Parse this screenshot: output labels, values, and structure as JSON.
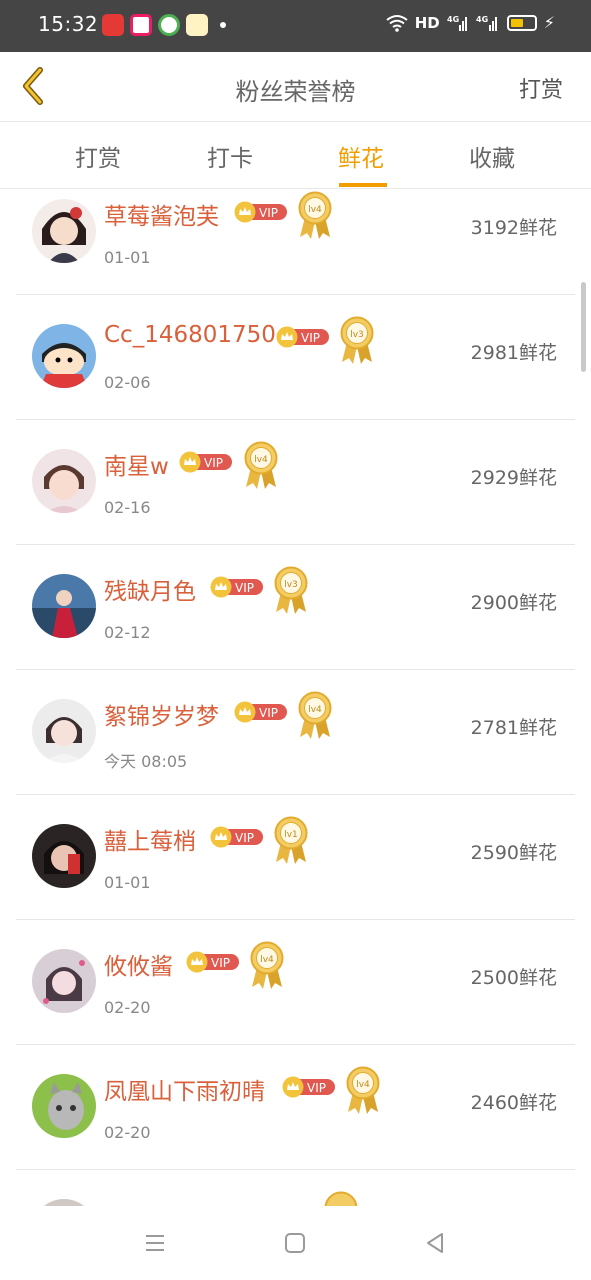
{
  "status_bar": {
    "time": "15:32",
    "network": "HD",
    "signal1": "4G",
    "signal2": "4G"
  },
  "header": {
    "title": "粉丝荣誉榜",
    "action": "打赏"
  },
  "tabs": [
    {
      "label": "打赏",
      "active": false
    },
    {
      "label": "打卡",
      "active": false
    },
    {
      "label": "鲜花",
      "active": true
    },
    {
      "label": "收藏",
      "active": false
    }
  ],
  "vip_label": "VIP",
  "rows": [
    {
      "name": "草莓酱泡芙",
      "date": "01-01",
      "level": "lv4",
      "count": "3192鲜花"
    },
    {
      "name": "Cc_146801750",
      "date": "02-06",
      "level": "lv3",
      "count": "2981鲜花"
    },
    {
      "name": "南星w",
      "date": "02-16",
      "level": "lv4",
      "count": "2929鲜花"
    },
    {
      "name": "残缺月色",
      "date": "02-12",
      "level": "lv3",
      "count": "2900鲜花"
    },
    {
      "name": "絮锦岁岁梦",
      "date": "今天 08:05",
      "level": "lv4",
      "count": "2781鲜花"
    },
    {
      "name": "囍上莓梢",
      "date": "01-01",
      "level": "lv1",
      "count": "2590鲜花"
    },
    {
      "name": "攸攸酱",
      "date": "02-20",
      "level": "lv4",
      "count": "2500鲜花"
    },
    {
      "name": "凤凰山下雨初晴",
      "date": "02-20",
      "level": "lv4",
      "count": "2460鲜花"
    }
  ],
  "colors": {
    "accent": "#f29d00",
    "name": "#d9603b",
    "vip": "#e0584f",
    "gold": "#e9b640"
  },
  "icons": {
    "back": "chevron-left-icon",
    "nav_menu": "menu-icon",
    "nav_home": "square-icon",
    "nav_back": "triangle-back-icon"
  }
}
